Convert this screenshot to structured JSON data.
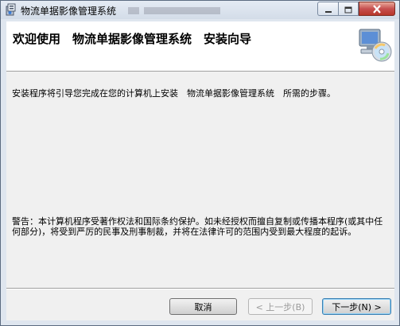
{
  "window": {
    "title": "物流单据影像管理系统",
    "app_icon": "installer-icon",
    "controls": {
      "minimize_icon": "minimize-icon",
      "maximize_icon": "maximize-icon",
      "close_icon": "close-icon"
    }
  },
  "banner": {
    "title": "欢迎使用　物流单据影像管理系统　安装向导",
    "icon": "computer-disc-icon"
  },
  "content": {
    "intro": "安装程序将引导您完成在您的计算机上安装　物流单据影像管理系统　所需的步骤。",
    "warning": "警告：本计算机程序受著作权法和国际条约保护。如未经授权而擅自复制或传播本程序(或其中任何部分)，将受到严厉的民事及刑事制裁，并将在法律许可的范围内受到最大程度的起诉。"
  },
  "buttons": {
    "cancel": "取消",
    "back": "< 上一步(B)",
    "next": "下一步(N) >"
  },
  "colors": {
    "close_button": "#c75050",
    "disabled_text": "#9a9a9a",
    "default_button_border": "#3c7fb1"
  }
}
